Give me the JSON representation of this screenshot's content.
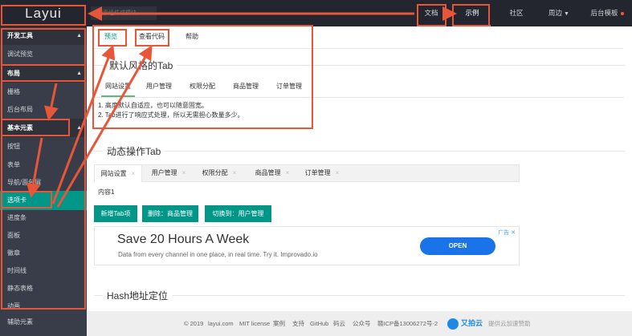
{
  "header": {
    "logo": "Layui",
    "search_placeholder": "搜索组件或模块",
    "nav": [
      {
        "label": "文档"
      },
      {
        "label": "示例"
      },
      {
        "label": "社区"
      },
      {
        "label": "周边"
      },
      {
        "label": "后台模板"
      }
    ]
  },
  "sidebar": {
    "sections": [
      {
        "label": "开发工具"
      },
      {
        "label": "布局"
      },
      {
        "label": "基本元素"
      }
    ],
    "items": [
      "调试预览",
      "栅格",
      "后台布局",
      "按钮",
      "表单",
      "导航/面包屑",
      "选项卡",
      "进度条",
      "面板",
      "徽章",
      "时间线",
      "静态表格",
      "动画",
      "辅助元素"
    ]
  },
  "page_tabs": [
    "预览",
    "查看代码",
    "帮助"
  ],
  "default_tab": {
    "legend": "默认风格的Tab",
    "tabs": [
      "网站设置",
      "用户管理",
      "权限分配",
      "商品管理",
      "订单管理"
    ],
    "content_line1": "1. 高度默认自适应，也可以随意固宽。",
    "content_line2": "2. Tab进行了响应式处理，所以无需担心数量多少。"
  },
  "dynamic_tab": {
    "legend": "动态操作Tab",
    "tabs": [
      "网站设置",
      "用户管理",
      "权限分配",
      "商品管理",
      "订单管理"
    ],
    "close_glyph": "×",
    "content": "内容1",
    "buttons": [
      "新增Tab项",
      "删除：商品管理",
      "切换到：用户管理"
    ]
  },
  "ad": {
    "title": "Save 20 Hours A Week",
    "subtitle": "Data from every channel in one place, in real time. Try it. Improvado.io",
    "button": "OPEN",
    "tag": "广告 ✕"
  },
  "hash_section": {
    "legend": "Hash地址定位"
  },
  "footer": {
    "copyright": "© 2019",
    "site": "layui.com",
    "license": "MIT license",
    "links": [
      "案例",
      "支持",
      "GitHub",
      "码云",
      "公众号"
    ],
    "icp": "赣ICP备13006272号-2",
    "brand": "又拍云",
    "brand_note": "提供云加速赞助"
  },
  "colors": {
    "header_bg": "#23262e",
    "sidebar_bg": "#393d49",
    "accent": "#009688",
    "annotation": "#e8563a"
  }
}
